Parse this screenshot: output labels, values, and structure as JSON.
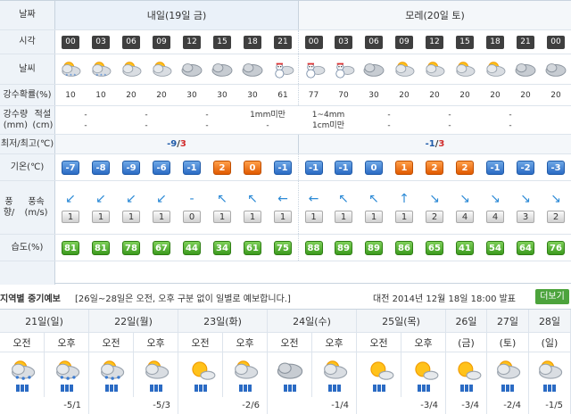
{
  "labels": {
    "date": "날짜",
    "time": "시각",
    "weather": "날씨",
    "pop": "강수확률(%)",
    "precip_line1": "강수량(mm)",
    "precip_line2": "적설(cm)",
    "minmax": "최저/최고(℃)",
    "temp": "기온(℃)",
    "wind_line1": "풍향/",
    "wind_line2": "풍속(m/s)",
    "humidity": "습도(%)"
  },
  "days": [
    {
      "label": "내일(19일 금)",
      "min": "-9",
      "max": "3"
    },
    {
      "label": "모레(20일 토)",
      "min": "-1",
      "max": "3"
    }
  ],
  "hours": [
    "00",
    "03",
    "06",
    "09",
    "12",
    "15",
    "18",
    "21",
    "00",
    "03",
    "06",
    "09",
    "12",
    "15",
    "18",
    "21",
    "00"
  ],
  "weather_icons": [
    "cloudy-snow-icon",
    "cloudy-snow-icon",
    "partly-cloudy-icon",
    "partly-cloudy-icon",
    "cloudy-icon",
    "cloudy-icon",
    "cloudy-icon",
    "snowman-icon",
    "snowman-icon",
    "snowman-icon",
    "cloudy-icon",
    "partly-cloudy-icon",
    "partly-cloudy-icon",
    "partly-cloudy-icon",
    "partly-cloudy-icon",
    "cloudy-icon",
    "cloudy-icon"
  ],
  "pop": [
    "10",
    "10",
    "20",
    "20",
    "30",
    "30",
    "30",
    "61",
    "77",
    "70",
    "30",
    "20",
    "20",
    "20",
    "20",
    "20",
    "20"
  ],
  "precip": [
    "-",
    "-",
    "-",
    "-",
    "1mm미만",
    "1~4mm",
    "-",
    "-",
    "-",
    "-"
  ],
  "snow": [
    "-",
    "-",
    "-",
    "-",
    "-",
    "1cm미만",
    "-",
    "-",
    "-",
    "-"
  ],
  "temps": [
    {
      "v": "-7",
      "c": "blue"
    },
    {
      "v": "-8",
      "c": "blue"
    },
    {
      "v": "-9",
      "c": "blue"
    },
    {
      "v": "-6",
      "c": "blue"
    },
    {
      "v": "-1",
      "c": "blue"
    },
    {
      "v": "2",
      "c": "orange"
    },
    {
      "v": "0",
      "c": "orange"
    },
    {
      "v": "-1",
      "c": "blue"
    },
    {
      "v": "-1",
      "c": "blue"
    },
    {
      "v": "-1",
      "c": "blue"
    },
    {
      "v": "0",
      "c": "blue"
    },
    {
      "v": "1",
      "c": "orange"
    },
    {
      "v": "2",
      "c": "orange"
    },
    {
      "v": "2",
      "c": "orange"
    },
    {
      "v": "-1",
      "c": "blue"
    },
    {
      "v": "-2",
      "c": "blue"
    },
    {
      "v": "-3",
      "c": "blue"
    }
  ],
  "wind_dirs": [
    "↙",
    "↙",
    "↙",
    "↙",
    "-",
    "↖",
    "↖",
    "←",
    "←",
    "↖",
    "↖",
    "↑",
    "↘",
    "↘",
    "↘",
    "↘",
    "↘"
  ],
  "wind_speeds": [
    "1",
    "1",
    "1",
    "1",
    "0",
    "1",
    "1",
    "1",
    "1",
    "1",
    "1",
    "1",
    "2",
    "4",
    "4",
    "3",
    "2"
  ],
  "humidity": [
    "81",
    "81",
    "78",
    "67",
    "44",
    "34",
    "61",
    "75",
    "88",
    "89",
    "89",
    "86",
    "65",
    "41",
    "54",
    "64",
    "76"
  ],
  "weekly": {
    "title": "지역별 중기예보",
    "note": "[26일~28일은 오전, 오후 구분 없이 일별로 예보합니다.]",
    "issued": "대전 2014년 12월 18일 18:00 발표",
    "more": "더보기",
    "am": "오전",
    "pm": "오후",
    "days": [
      {
        "label": "21일(일)",
        "temp": "-5/1",
        "split": true,
        "icons": [
          "snow-cloud-icon",
          "snow-cloud-icon"
        ]
      },
      {
        "label": "22일(월)",
        "temp": "-5/3",
        "split": true,
        "icons": [
          "snow-cloud-icon",
          "partly-cloudy-icon"
        ]
      },
      {
        "label": "23일(화)",
        "temp": "-2/6",
        "split": true,
        "icons": [
          "sunny-icon",
          "partly-cloudy-icon"
        ]
      },
      {
        "label": "24일(수)",
        "temp": "-1/4",
        "split": true,
        "icons": [
          "cloudy-icon",
          "partly-cloudy-icon"
        ]
      },
      {
        "label": "25일(목)",
        "temp": "-3/4",
        "split": true,
        "icons": [
          "sunny-icon",
          "sunny-icon"
        ]
      },
      {
        "label": "26일",
        "sub": "(금)",
        "temp": "-3/4",
        "split": false,
        "icons": [
          "sunny-icon"
        ]
      },
      {
        "label": "27일",
        "sub": "(토)",
        "temp": "-2/4",
        "split": false,
        "icons": [
          "partly-cloudy-icon"
        ]
      },
      {
        "label": "28일",
        "sub": "(일)",
        "temp": "-1/5",
        "split": false,
        "icons": [
          "partly-cloudy-icon"
        ]
      }
    ]
  }
}
